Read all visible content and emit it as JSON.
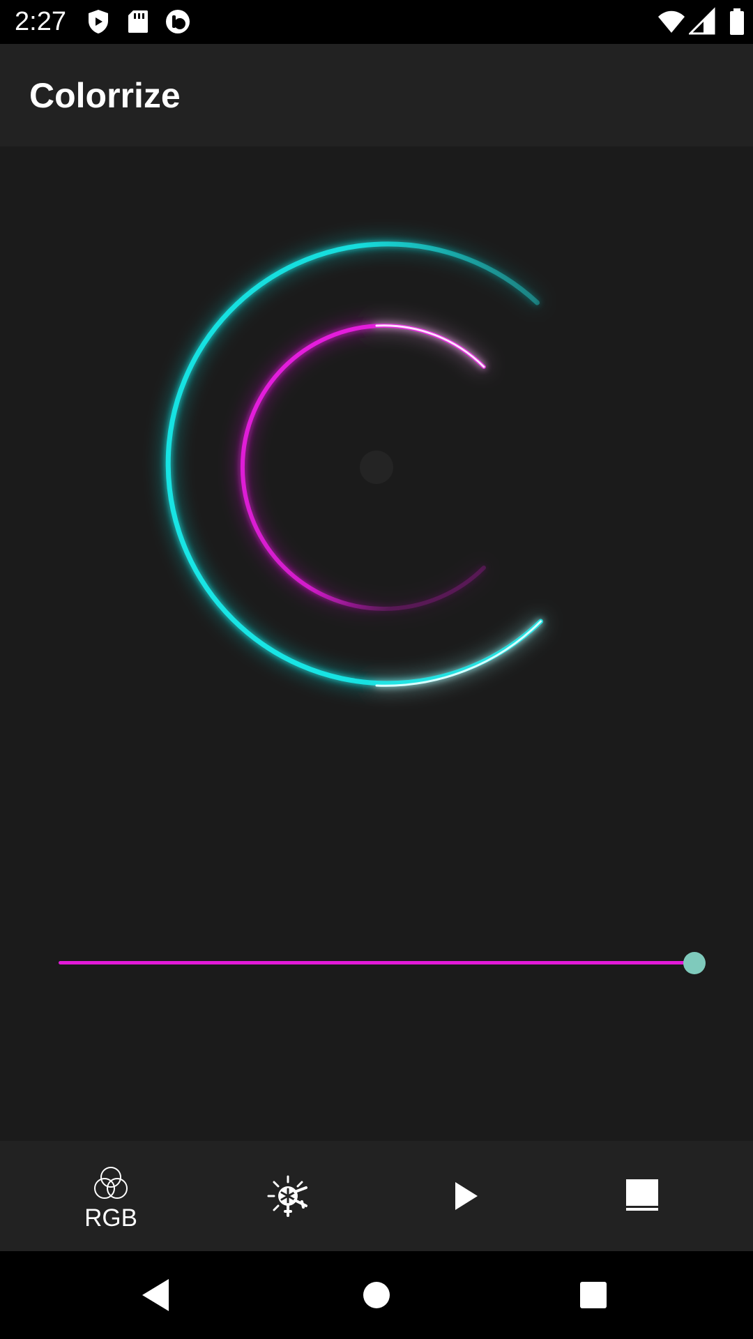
{
  "status_bar": {
    "time": "2:27",
    "left_icons": [
      "shield-icon",
      "sd-card-icon",
      "app-badge-icon"
    ],
    "right_icons": [
      "wifi-icon",
      "cell-signal-icon",
      "battery-icon"
    ]
  },
  "app_bar": {
    "title": "Colorrize"
  },
  "colors": {
    "outer_ring": "#19e6e6",
    "inner_ring": "#e81ce0",
    "slider_track": "#e21ad8",
    "slider_thumb": "#7fcabc",
    "background": "#1b1b1b",
    "bar_background": "#222222"
  },
  "slider": {
    "value_fraction": 1.0
  },
  "bottom_nav": {
    "items": [
      {
        "id": "rgb",
        "icon": "rgb-circles-icon",
        "label": "RGB"
      },
      {
        "id": "effects",
        "icon": "sun-snowflake-icon",
        "label": ""
      },
      {
        "id": "play",
        "icon": "play-icon",
        "label": ""
      },
      {
        "id": "layout",
        "icon": "panel-icon",
        "label": ""
      }
    ]
  },
  "system_nav": {
    "buttons": [
      "back-icon",
      "home-icon",
      "recents-icon"
    ]
  }
}
